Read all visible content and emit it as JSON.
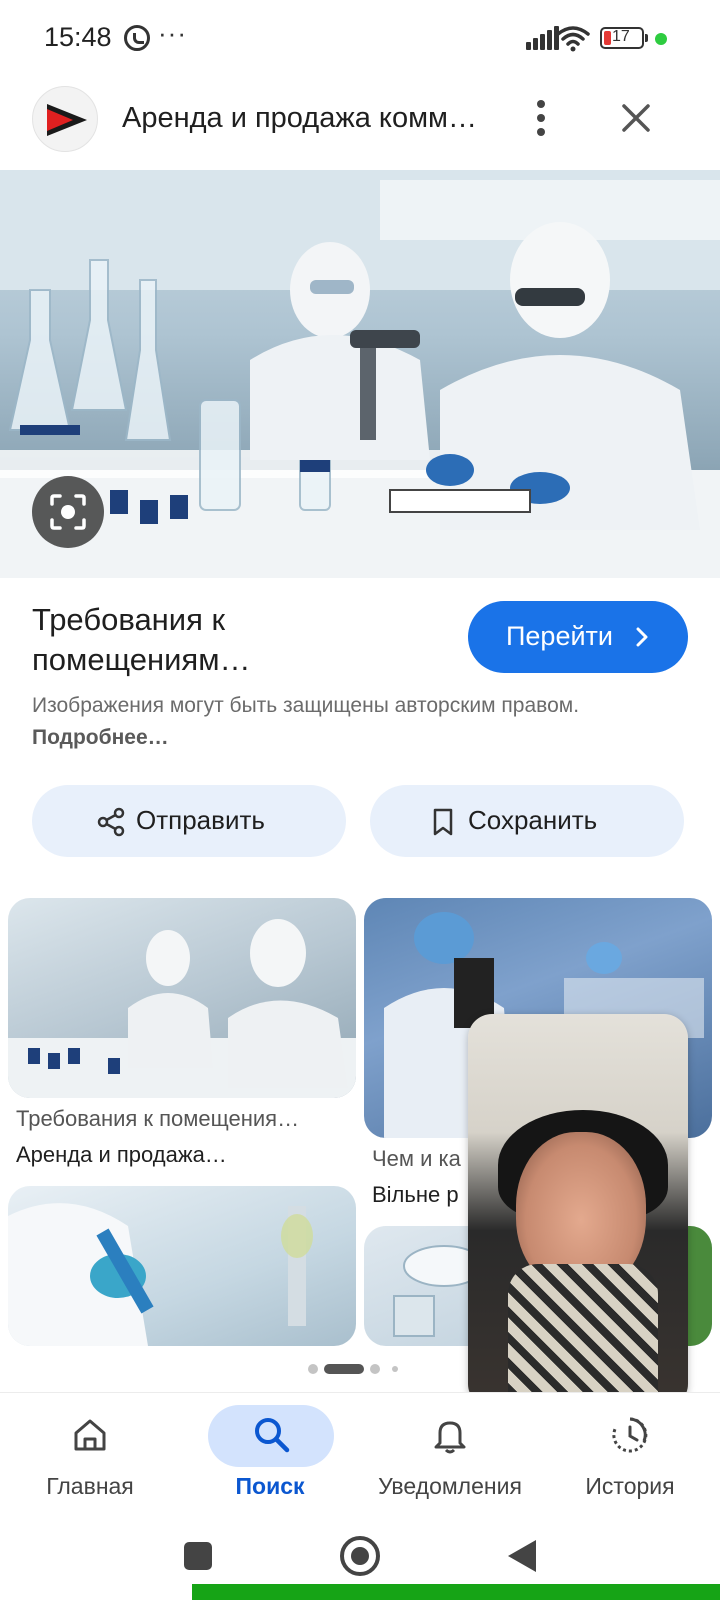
{
  "status_bar": {
    "time": "15:48",
    "dots": "···",
    "battery": "17",
    "icons": [
      "whatsapp-icon",
      "signal-icon",
      "wifi-icon",
      "battery-icon"
    ]
  },
  "header": {
    "title": "Аренда и продажа комме…",
    "icons": [
      "site-logo",
      "more-vert-icon",
      "close-icon"
    ]
  },
  "result": {
    "title_line1": "Требования к",
    "title_line2": "помещениям…",
    "visit_label": "Перейти",
    "copyright_text": "Изображения могут быть защищены авторским правом.",
    "more_link": "Подробнее…"
  },
  "actions": {
    "share_label": "Отправить",
    "save_label": "Сохранить"
  },
  "grid": {
    "items": [
      {
        "title": "Требования к помещения…",
        "source": "Аренда и продажа…"
      },
      {
        "title": "Чем и ка",
        "source": "Вільне р"
      }
    ]
  },
  "bottom_nav": {
    "items": [
      {
        "label": "Главная",
        "icon": "home-icon"
      },
      {
        "label": "Поиск",
        "icon": "search-icon",
        "active": true
      },
      {
        "label": "Уведомления",
        "icon": "bell-icon"
      },
      {
        "label": "История",
        "icon": "history-icon"
      }
    ]
  },
  "colors": {
    "accent": "#1a73e8",
    "active_nav": "#0b57d0",
    "pill_bg": "#e8f0fb",
    "battery_low": "#e53935"
  }
}
